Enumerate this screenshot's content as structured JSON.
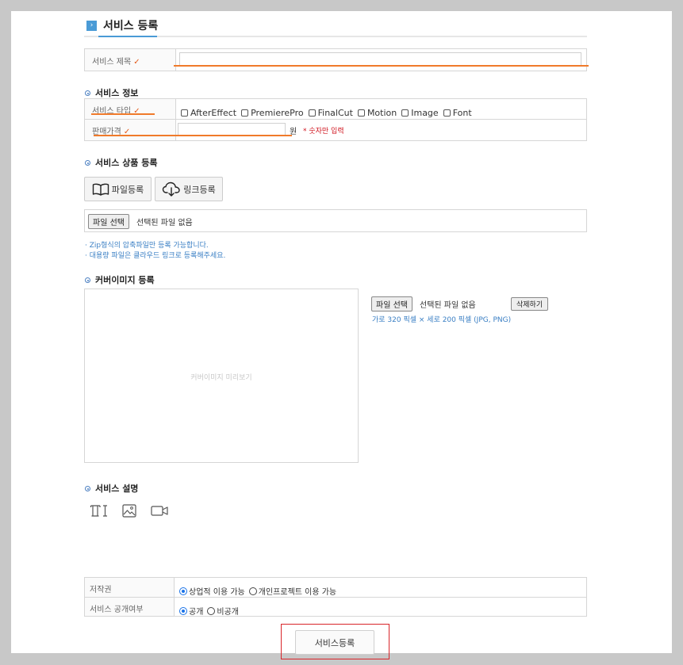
{
  "header": {
    "title": "서비스 등록",
    "icon": "chevron-right-icon"
  },
  "basic": {
    "service_title_label": "서비스 제목",
    "service_title_value": "",
    "required_mark": "✓"
  },
  "service_info": {
    "heading": "서비스 정보",
    "type_label": "서비스 타입",
    "type_options": [
      "AfterEffect",
      "PremierePro",
      "FinalCut",
      "Motion",
      "Image",
      "Font"
    ],
    "price_label": "판매가격",
    "price_value": "",
    "price_unit": "원",
    "price_note": "* 숫자만 입력"
  },
  "product": {
    "heading": "서비스 상품 등록",
    "file_register_label": "파일등록",
    "link_register_label": "링크등록",
    "choose_file_label": "파일 선택",
    "no_file_text": "선택된 파일 없음",
    "note1": "· Zip형식의 압축파일만 등록 가능합니다.",
    "note2": "· 대용량 파일은 클라우드 링크로 등록해주세요."
  },
  "cover": {
    "heading": "커버이미지 등록",
    "preview_text": "커버이미지 미리보기",
    "choose_file_label": "파일 선택",
    "no_file_text": "선택된 파일 없음",
    "delete_label": "삭제하기",
    "size_note": "가로 320 픽셀 × 세로 200 픽셀 (JPG, PNG)"
  },
  "description": {
    "heading": "서비스 설명",
    "tools": [
      "text-icon",
      "image-icon",
      "video-icon"
    ]
  },
  "rights": {
    "copyright_label": "저작권",
    "copyright_options": [
      "상업적 이용 가능",
      "개인프로젝트 이용 가능"
    ],
    "copyright_selected": "상업적 이용 가능",
    "visibility_label": "서비스 공개여부",
    "visibility_options": [
      "공개",
      "비공개"
    ],
    "visibility_selected": "공개"
  },
  "submit_label": "서비스등록",
  "colors": {
    "accent": "#4a9bd6",
    "required": "#e35a1a",
    "note": "#3a7fc4",
    "error": "#d0141e",
    "highlight_box": "#d9252a"
  }
}
